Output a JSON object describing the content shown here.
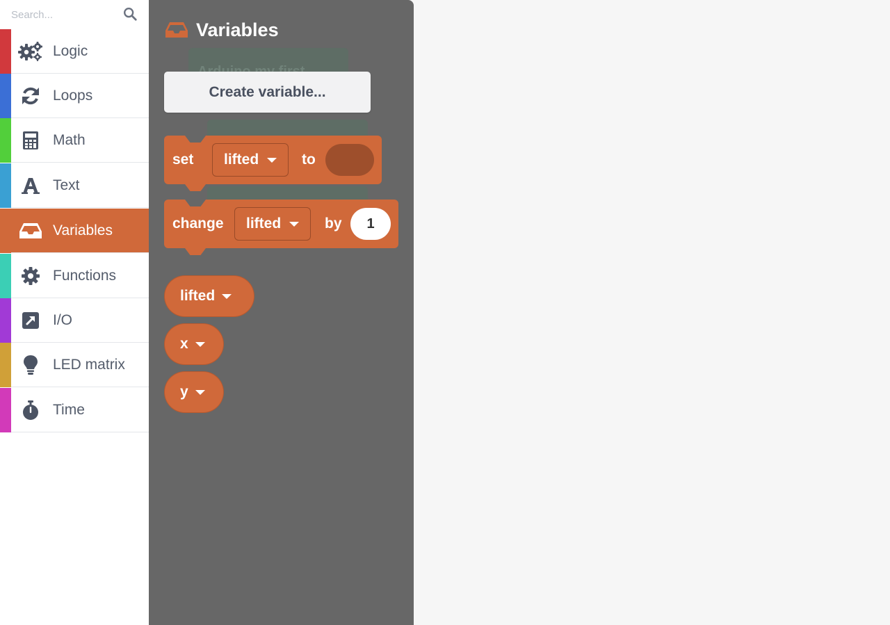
{
  "search": {
    "placeholder": "Search..."
  },
  "categories": [
    {
      "label": "Logic",
      "color": "#d1393d",
      "icon": "gears-icon"
    },
    {
      "label": "Loops",
      "color": "#3b6fd6",
      "icon": "sync-icon"
    },
    {
      "label": "Math",
      "color": "#52cf3b",
      "icon": "calculator-icon"
    },
    {
      "label": "Text",
      "color": "#3aa0d3",
      "icon": "font-icon"
    },
    {
      "label": "Variables",
      "color": "#d0693a",
      "icon": "inbox-icon",
      "selected": true
    },
    {
      "label": "Functions",
      "color": "#3bcfb5",
      "icon": "gear-icon"
    },
    {
      "label": "I/O",
      "color": "#a13ad6",
      "icon": "external-square-icon"
    },
    {
      "label": "LED matrix",
      "color": "#d0a038",
      "icon": "lightbulb-icon"
    },
    {
      "label": "Time",
      "color": "#d23ab9",
      "icon": "stopwatch-icon"
    }
  ],
  "flyout": {
    "title": "Variables",
    "ghost_text": "Arduino my first",
    "create_button": "Create variable...",
    "set_block": {
      "keyword": "set",
      "variable": "lifted",
      "to": "to"
    },
    "change_block": {
      "keyword": "change",
      "variable": "lifted",
      "by": "by",
      "amount": "1"
    },
    "variables": [
      "lifted",
      "x",
      "y"
    ]
  },
  "colors": {
    "accent": "#d0693a",
    "flyout_bg": "#676767",
    "workspace_bg": "#f6f6f6"
  }
}
